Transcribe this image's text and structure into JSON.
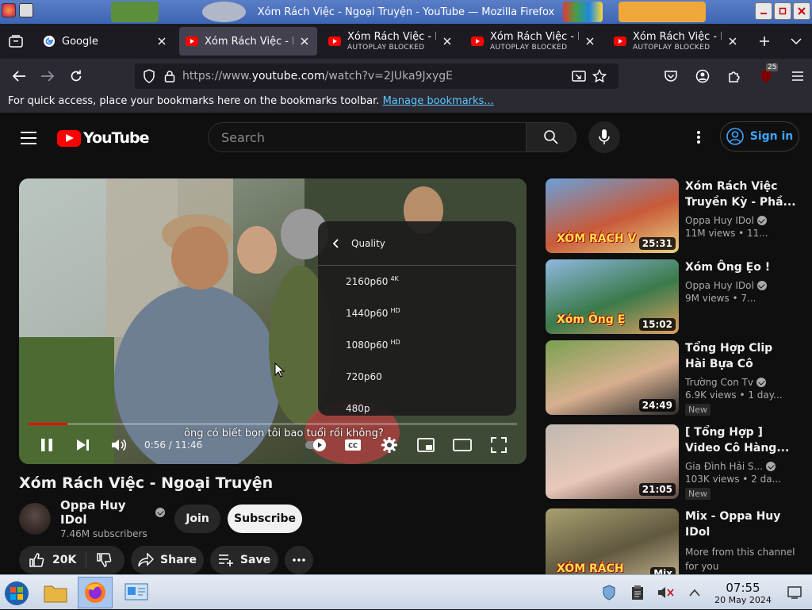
{
  "window": {
    "title": "Xóm Rách Việc - Ngoại Truyện - YouTube — Mozilla Firefox"
  },
  "tabs": [
    {
      "label": "Google",
      "sub": "",
      "icon": "google-icon",
      "active": false
    },
    {
      "label": "Xóm Rách Việc - N",
      "sub": "",
      "icon": "youtube-icon",
      "active": true
    },
    {
      "label": "Xóm Rách Việc - N",
      "sub": "AUTOPLAY BLOCKED",
      "icon": "youtube-icon",
      "active": false
    },
    {
      "label": "Xóm Rách Việc - N",
      "sub": "AUTOPLAY BLOCKED",
      "icon": "youtube-icon",
      "active": false
    },
    {
      "label": "Xóm Rách Việc - N",
      "sub": "AUTOPLAY BLOCKED",
      "icon": "youtube-icon",
      "active": false
    }
  ],
  "nav": {
    "url_prefix": "https://www.",
    "url_domain": "youtube.com",
    "url_path": "/watch?v=2JUka9JxygE",
    "extension_badge": "25"
  },
  "bookmarks": {
    "text": "For quick access, place your bookmarks here on the bookmarks toolbar.",
    "link": "Manage bookmarks..."
  },
  "yt": {
    "logo_text": "YouTube",
    "search_placeholder": "Search",
    "signin_label": "Sign in"
  },
  "player": {
    "time": "0:56 / 11:46",
    "progress": 0.079,
    "subtitle": "ông có biết bọn tôi bao tuổi rồi không?",
    "quality_menu": {
      "title": "Quality",
      "options": [
        {
          "label": "2160p60",
          "badge": "4K"
        },
        {
          "label": "1440p60",
          "badge": "HD"
        },
        {
          "label": "1080p60",
          "badge": "HD"
        },
        {
          "label": "720p60",
          "badge": ""
        },
        {
          "label": "480p",
          "badge": ""
        }
      ]
    }
  },
  "video": {
    "title": "Xóm Rách Việc - Ngoại Truyện",
    "channel": "Oppa Huy IDol",
    "subscribers": "7.46M subscribers",
    "join_label": "Join",
    "subscribe_label": "Subscribe",
    "likes": "20K",
    "share_label": "Share",
    "save_label": "Save"
  },
  "recommendations": [
    {
      "title": "Xóm Rách Việc Truyền Kỳ - Phầ...",
      "channel": "Oppa Huy IDol",
      "verified": true,
      "meta": "11M views • 11...",
      "duration": "25:31",
      "badge": "",
      "thumb_text": "XÓM RÁCH V"
    },
    {
      "title": "Xóm Ông Ẹo !",
      "channel": "Oppa Huy IDol",
      "verified": true,
      "meta": "9M views • 7...",
      "duration": "15:02",
      "badge": "",
      "thumb_text": "Xóm Ông Ẹ"
    },
    {
      "title": "Tổng Hợp Clip Hài Bựa Cô Chin...",
      "channel": "Trường Con Tv",
      "verified": true,
      "meta": "6.9K views • 1 day...",
      "duration": "24:49",
      "badge": "New",
      "thumb_text": ""
    },
    {
      "title": "[ Tổng Hợp ] Video Cô Hàng...",
      "channel": "Gia Đình Hải S...",
      "verified": true,
      "meta": "103K views • 2 da...",
      "duration": "21:05",
      "badge": "New",
      "thumb_text": ""
    },
    {
      "title": "Mix - Oppa Huy IDol",
      "channel": "More from this channel for you",
      "verified": false,
      "meta": "",
      "duration": "Mix",
      "badge": "",
      "thumb_text": "XÓM RÁCH"
    }
  ],
  "taskbar": {
    "time": "07:55",
    "date": "20 May 2024"
  }
}
